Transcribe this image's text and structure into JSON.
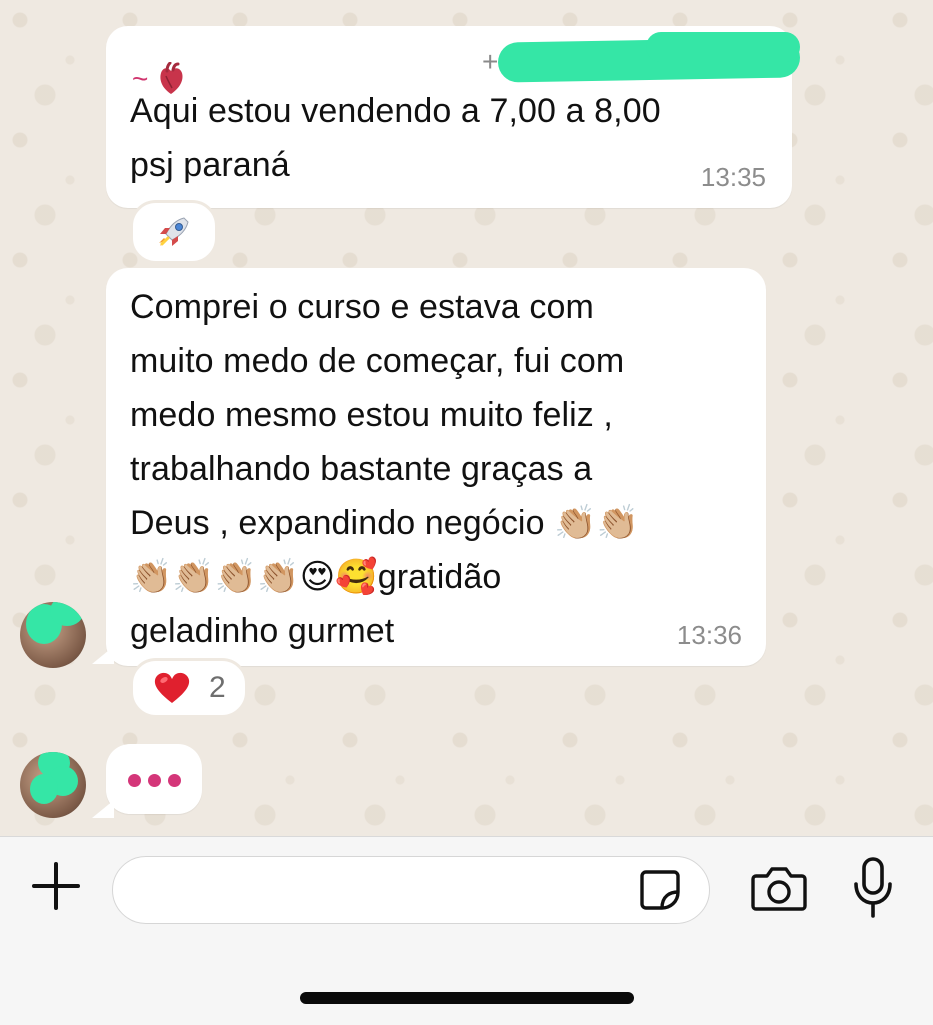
{
  "colors": {
    "wallpaper": "#efe9e1",
    "bubble": "#ffffff",
    "sender_name": "#d0336d",
    "typing_dots": "#d43679",
    "timestamp": "#8c8c8c",
    "redaction": "#35e6a6"
  },
  "messages": [
    {
      "sender_prefix": "~",
      "sender_emoji": "anatomical-heart-icon",
      "phone_prefix": "+",
      "text": "Aqui estou vendendo a 7,00 a 8,00\npsj paraná",
      "time": "13:35",
      "reaction": {
        "emoji": "🚀",
        "icon": "rocket-icon"
      }
    },
    {
      "text": "Comprei o curso e estava com\nmuito medo de começar, fui com\nmedo mesmo estou muito feliz ,\ntrabalhando bastante graças a\nDeus , expandindo negócio 👏🏼👏🏼\n👏🏼👏🏼👏🏼👏🏼😍🥰gratidão\ngeladinho gurmet",
      "time": "13:36",
      "reaction": {
        "emoji": "❤️",
        "icon": "red-heart-icon",
        "count": "2"
      }
    }
  ],
  "typing_indicator": {
    "icon": "typing-dots-icon"
  },
  "composer": {
    "placeholder": "",
    "icons": [
      "plus-icon",
      "sticker-icon",
      "camera-icon",
      "microphone-icon"
    ]
  }
}
